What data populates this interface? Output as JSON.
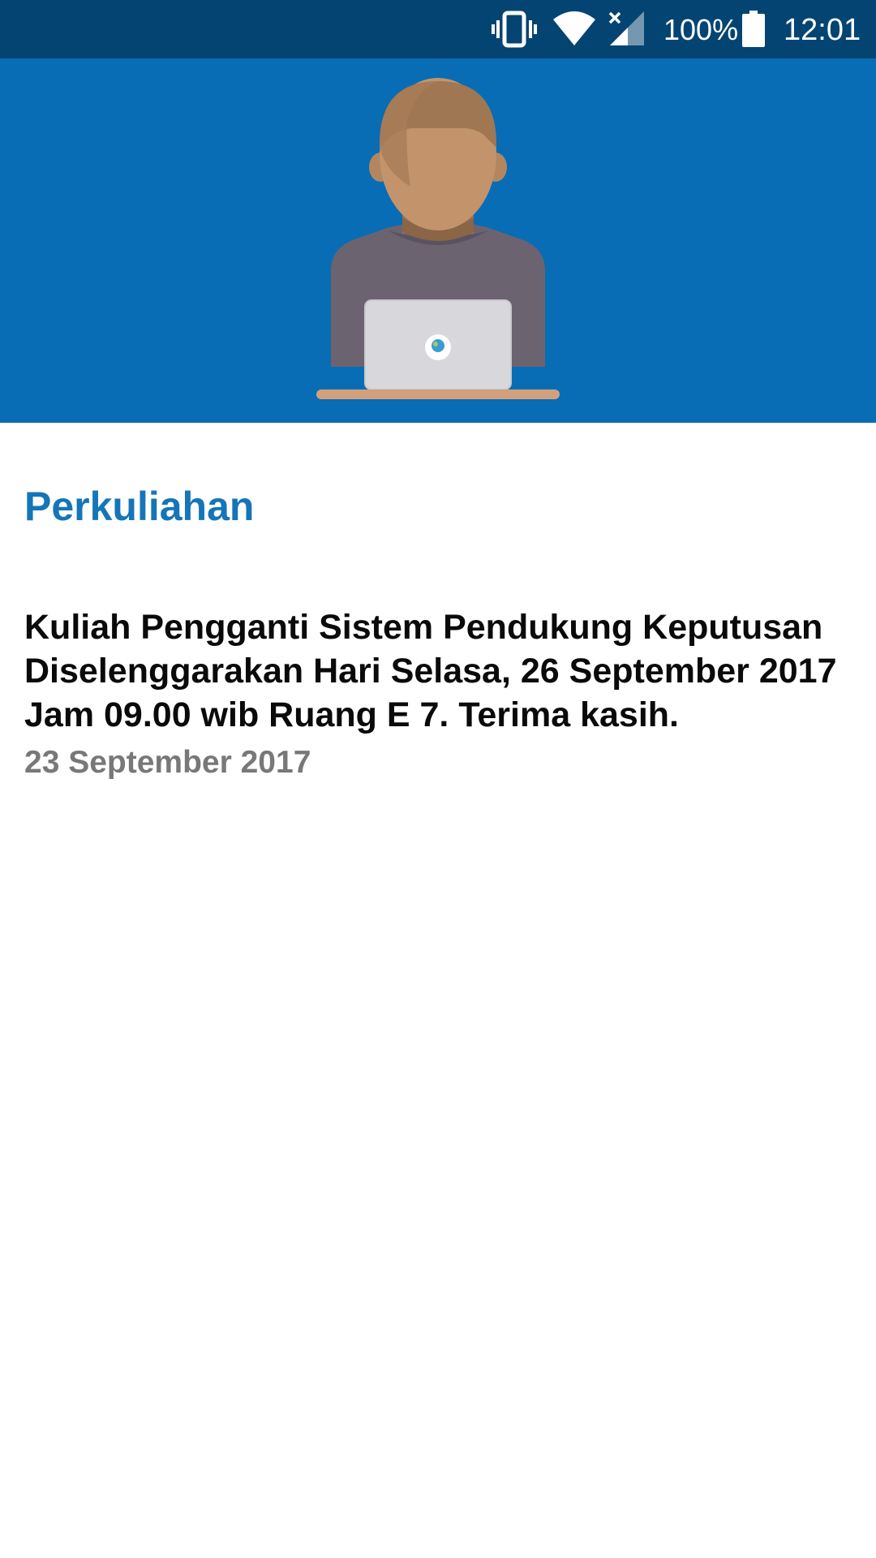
{
  "status_bar": {
    "icons": [
      "vibrate-icon",
      "wifi-icon",
      "signal-no-sim-icon",
      "battery-icon"
    ],
    "battery_percent": "100%",
    "time": "12:01",
    "background_color": "#044472"
  },
  "header": {
    "illustration": "person-with-laptop-illustration",
    "background_color": "#086db4"
  },
  "section": {
    "title": "Perkuliahan",
    "title_color": "#1575b8"
  },
  "announcement": {
    "text": "Kuliah Pengganti Sistem Pendukung Keputusan Diselenggarakan Hari Selasa, 26 September 2017 Jam 09.00 wib Ruang E 7. Terima kasih.",
    "date": "23 September 2017"
  }
}
